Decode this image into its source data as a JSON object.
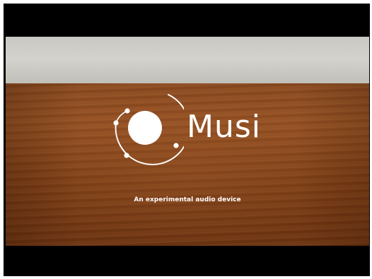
{
  "video": {
    "brand_name": "Musi",
    "tagline": "An experimental audio device",
    "logo_icon": "orbit-logo-icon"
  },
  "colors": {
    "letterbox": "#000000",
    "wall": "#cfcec8",
    "wood": "#8a4a20",
    "text": "#ffffff"
  }
}
